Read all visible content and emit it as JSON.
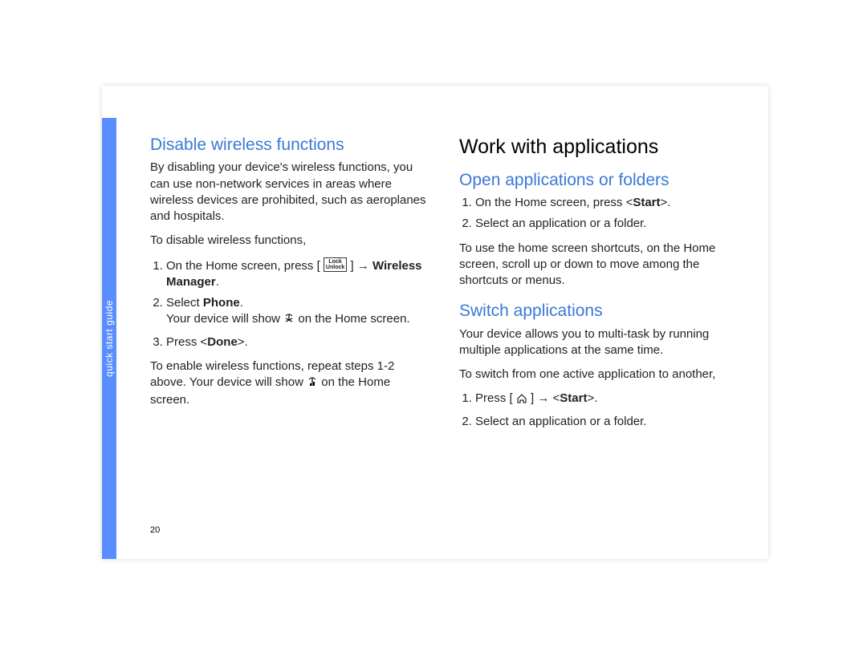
{
  "tab_label": "quick start guide",
  "page_number": "20",
  "left": {
    "heading": "Disable wireless functions",
    "intro": "By disabling your device's wireless functions, you can use non-network services in areas where wireless devices are prohibited, such as aeroplanes and hospitals.",
    "lead": "To disable wireless functions,",
    "step1_pre": "On the Home screen, press [",
    "step1_icon_l1": "Lock",
    "step1_icon_l2": "Unlock",
    "step1_post": "] →",
    "step1_bold": "Wireless Manager",
    "step1_tail": ".",
    "step2_pre": "Select ",
    "step2_bold": "Phone",
    "step2_tail": ".",
    "step2_note_pre": "Your device will show ",
    "step2_note_post": " on the Home screen.",
    "step3_pre": "Press <",
    "step3_bold": "Done",
    "step3_tail": ">.",
    "outro_pre": "To enable wireless functions, repeat steps 1-2 above. Your device will show ",
    "outro_post": " on the Home screen."
  },
  "right": {
    "heading_main": "Work with applications",
    "heading_open": "Open applications or folders",
    "open_step1_pre": "On the Home screen, press <",
    "open_step1_bold": "Start",
    "open_step1_tail": ">.",
    "open_step2": "Select an application or a folder.",
    "open_note": "To use the home screen shortcuts, on the Home screen, scroll up or down to move among the shortcuts or menus.",
    "heading_switch": "Switch applications",
    "switch_intro": "Your device allows you to multi-task by running multiple applications at the same time.",
    "switch_lead": "To switch from one active application to another,",
    "switch_step1_pre": "Press [",
    "switch_step1_mid": "] → <",
    "switch_step1_bold": "Start",
    "switch_step1_tail": ">.",
    "switch_step2": "Select an application or a folder."
  }
}
